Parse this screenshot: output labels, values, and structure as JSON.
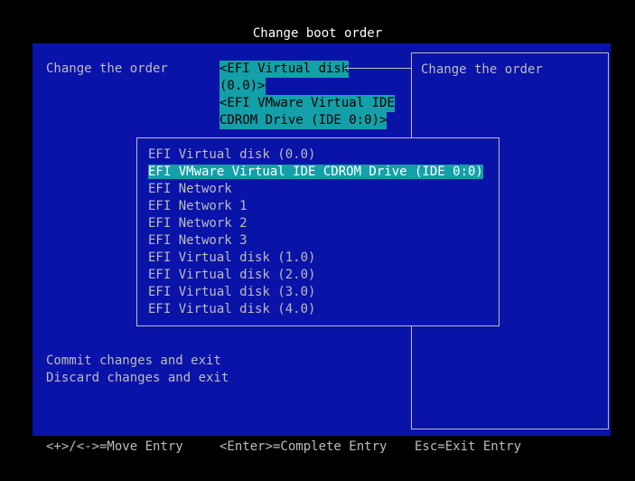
{
  "title": "Change boot order",
  "main": {
    "field_label": "Change the order",
    "value_lines": [
      "<EFI Virtual disk",
      "(0.0)>",
      "<EFI VMware Virtual IDE",
      "CDROM Drive (IDE 0:0)>"
    ],
    "help_text": "Change the order",
    "actions": [
      "Commit changes and exit",
      "Discard changes and exit"
    ]
  },
  "popup": {
    "selected_index": 1,
    "items": [
      "EFI Virtual disk (0.0)",
      "EFI VMware Virtual IDE CDROM Drive (IDE 0:0)",
      "EFI Network",
      "EFI Network 1",
      "EFI Network 2",
      "EFI Network 3",
      "EFI Virtual disk (1.0)",
      "EFI Virtual disk (2.0)",
      "EFI Virtual disk (3.0)",
      "EFI Virtual disk (4.0)"
    ]
  },
  "footer": {
    "move": "<+>/<->=Move Entry",
    "complete": "<Enter>=Complete Entry",
    "exit": "Esc=Exit Entry"
  },
  "colors": {
    "background": "#000000",
    "panel": "#0a13a7",
    "highlight": "#13a0a8",
    "text": "#bcbcbc",
    "title": "#ffffff"
  }
}
